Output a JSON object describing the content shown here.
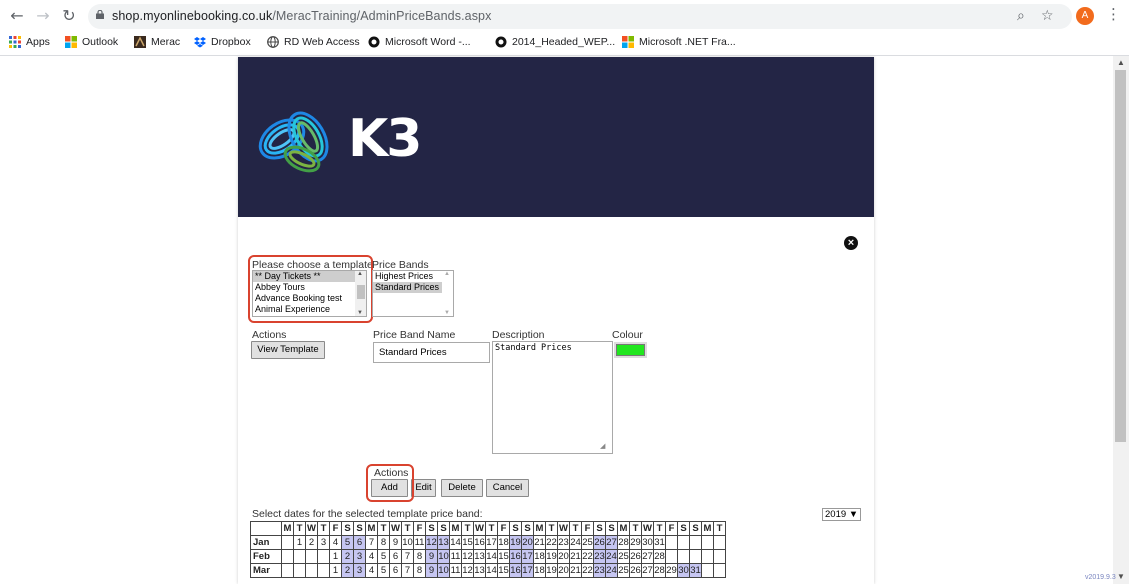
{
  "browser": {
    "url_host": "shop.myonlinebooking.co.uk",
    "url_path": "/MeracTraining/AdminPriceBands.aspx",
    "avatar_letter": "A",
    "bookmarks": [
      "Apps",
      "Outlook",
      "Merac",
      "Dropbox",
      "RD Web Access",
      "Microsoft Word -...",
      "2014_Headed_WEP...",
      "Microsoft .NET Fra..."
    ]
  },
  "banner": {
    "logo_text": "K3",
    "background": "#232545"
  },
  "template": {
    "label": "Please choose a template",
    "options": [
      "** Day Tickets **",
      "Abbey Tours",
      "Advance Booking test",
      "Animal Experience"
    ],
    "selected_index": 0
  },
  "price_bands": {
    "label": "Price Bands",
    "options": [
      "Highest Prices",
      "Standard Prices"
    ],
    "selected_index": 1
  },
  "actions1": {
    "label": "Actions",
    "view_template": "View Template"
  },
  "band_name": {
    "label": "Price Band Name",
    "value": "Standard Prices"
  },
  "description": {
    "label": "Description",
    "value": "Standard Prices"
  },
  "colour": {
    "label": "Colour",
    "value": "#21e61f"
  },
  "actions2": {
    "label": "Actions",
    "add": "Add",
    "edit": "Edit",
    "delete": "Delete",
    "cancel": "Cancel"
  },
  "calendar": {
    "prompt": "Select dates for the selected template price band:",
    "year": "2019 ▼",
    "day_headers": [
      "M",
      "T",
      "W",
      "T",
      "F",
      "S",
      "S",
      "M",
      "T",
      "W",
      "T",
      "F",
      "S",
      "S",
      "M",
      "T",
      "W",
      "T",
      "F",
      "S",
      "S",
      "M",
      "T",
      "W",
      "T",
      "F",
      "S",
      "S",
      "M",
      "T",
      "W",
      "T",
      "F",
      "S",
      "S",
      "M",
      "T"
    ],
    "months": [
      {
        "name": "Jan",
        "offset": 1,
        "days": 31
      },
      {
        "name": "Feb",
        "offset": 4,
        "days": 28
      },
      {
        "name": "Mar",
        "offset": 4,
        "days": 31
      }
    ]
  },
  "version": "v2019.9.3"
}
